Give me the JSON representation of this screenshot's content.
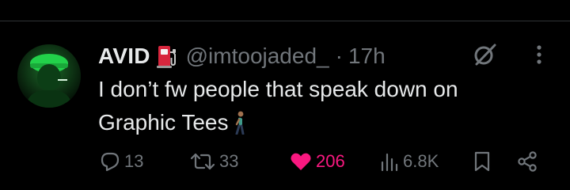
{
  "tweet": {
    "author": {
      "display_name": "AVID",
      "handle": "@imtoojaded_",
      "badge_icon": "fuel-pump-icon",
      "avatar": "avatar-green-photo"
    },
    "separator": "·",
    "time": "17h",
    "text_line1": "I don’t fw people that speak down on",
    "text_line2": "Graphic Tees",
    "emoji": "person-walking-emoji"
  },
  "actions": {
    "reply_count": "13",
    "repost_count": "33",
    "like_count": "206",
    "view_count": "6.8K"
  },
  "header_icons": [
    "grok-icon",
    "more-icon"
  ],
  "colors": {
    "background": "#000000",
    "text": "#e7e9ea",
    "secondary": "#71767b",
    "like": "#f91880",
    "divider": "#2f3336",
    "avatar_accent": "#22d14a"
  }
}
